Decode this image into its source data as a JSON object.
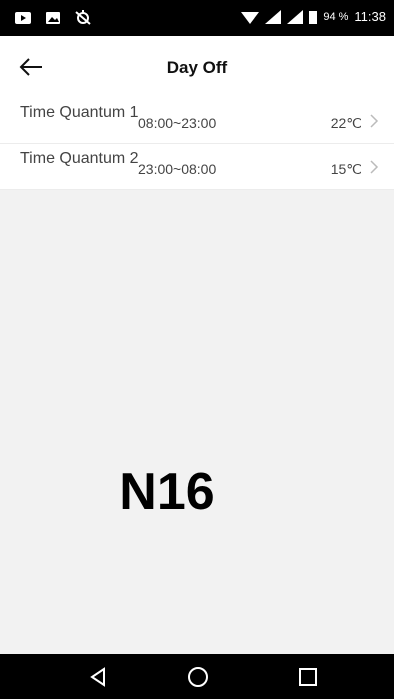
{
  "status_bar": {
    "battery_percent": "94 %",
    "time": "11:38",
    "icons": [
      "youtube-icon",
      "image-icon",
      "location-off-icon",
      "wifi-icon",
      "signal-icon",
      "signal-icon",
      "battery-icon"
    ]
  },
  "header": {
    "title": "Day Off"
  },
  "time_quanta": [
    {
      "name": "Time Quantum 1",
      "range": "08:00~23:00",
      "temperature": "22℃"
    },
    {
      "name": "Time Quantum 2",
      "range": "23:00~08:00",
      "temperature": "15℃"
    }
  ],
  "watermark": "N16",
  "nav_bar": {
    "buttons": [
      "back-icon",
      "home-icon",
      "recents-icon"
    ]
  },
  "colors": {
    "status_bar_bg": "#000000",
    "page_bg": "#f2f2f2",
    "panel_bg": "#ffffff"
  }
}
